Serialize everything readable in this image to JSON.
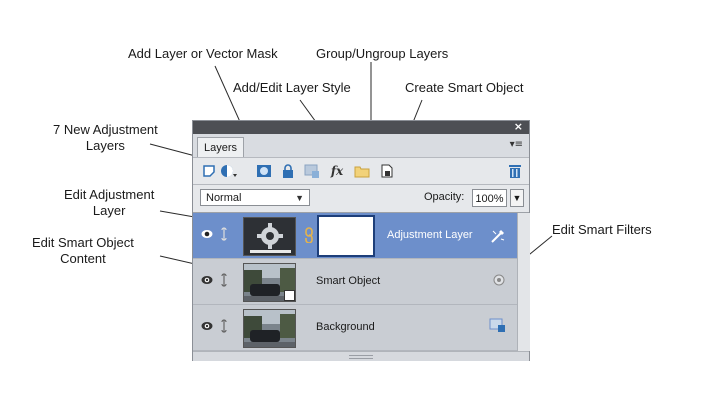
{
  "callouts": {
    "add_mask": "Add Layer or Vector Mask",
    "group": "Group/Ungroup Layers",
    "layer_style": "Add/Edit Layer Style",
    "smart_object": "Create Smart Object",
    "new_adjustment": "7 New Adjustment\nLayers",
    "edit_adjustment": "Edit Adjustment\nLayer",
    "edit_smart_content": "Edit Smart Object\nContent",
    "edit_smart_filters": "Edit Smart Filters"
  },
  "panel": {
    "close_glyph": "×",
    "tab_label": "Layers",
    "menu_glyph": "▾≡",
    "blend_mode": "Normal",
    "opacity_label": "Opacity:",
    "opacity_value": "100%",
    "fx_label": "fx"
  },
  "toolbar_icons": [
    "new-layer-icon",
    "adjustment-layer-icon",
    "mask-icon",
    "lock-icon",
    "lock-transparency-icon",
    "fx-icon",
    "folder-icon",
    "smart-object-icon",
    "trash-icon"
  ],
  "layers": [
    {
      "name": "Adjustment Layer",
      "selected": true,
      "thumb": "adjustment-gear-icon",
      "extra_icon": "smart-filter-edit-icon"
    },
    {
      "name": "Smart Object",
      "selected": false,
      "thumb": "street-photo",
      "extra_icon": "smart-filters-icon"
    },
    {
      "name": "Background",
      "selected": false,
      "thumb": "street-photo",
      "extra_icon": "lock-transparency-icon"
    }
  ],
  "colors": {
    "selected_row": "#6d8fcb",
    "titlebar": "#4d4f54",
    "icon_blue": "#2f6fb3"
  }
}
